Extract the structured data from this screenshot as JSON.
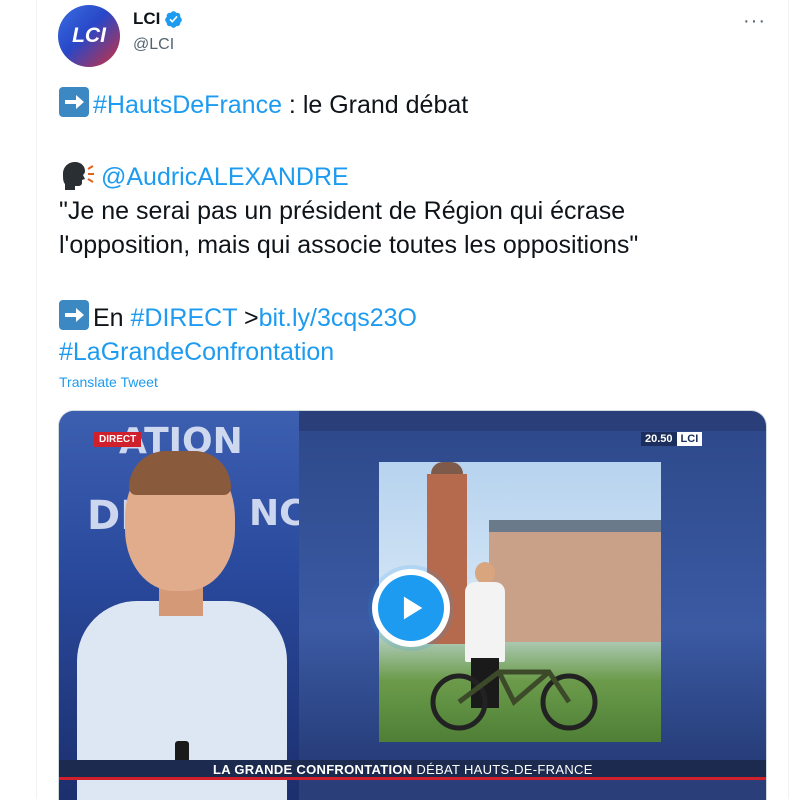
{
  "user": {
    "name": "LCI",
    "handle": "@LCI",
    "avatar_text": "LCI",
    "verified_icon": "verified-badge-icon"
  },
  "more_menu": "···",
  "tweet": {
    "line1_hashtag": "#HautsDeFrance",
    "line1_rest": " : le Grand débat",
    "line2_mention": "@AudricALEXANDRE",
    "quote_line1": " \"Je ne serai pas un président de Région qui écrase",
    "quote_line2": "l'opposition, mais qui associe toutes les oppositions\"",
    "line5_prefix": "En ",
    "line5_hashtag": "#DIRECT",
    "line5_sep": " >",
    "line5_link": "bit.ly/3cqs23O",
    "line6_hashtag": "#LaGrandeConfrontation"
  },
  "translate_label": "Translate Tweet",
  "video": {
    "direct_badge": "DIRECT",
    "time": "20.50",
    "channel": "LCI",
    "studio_word1": "ATION",
    "studio_word2": "DÉ",
    "studio_word3": "NC",
    "lower_third_bold": "LA GRANDE CONFRONTATION",
    "lower_third_rest": "DÉBAT HAUTS-DE-FRANCE"
  },
  "colors": {
    "link": "#1d9bf0",
    "text": "#0f1419",
    "secondary": "#536471",
    "arrow_emoji": "#3b88c3"
  }
}
